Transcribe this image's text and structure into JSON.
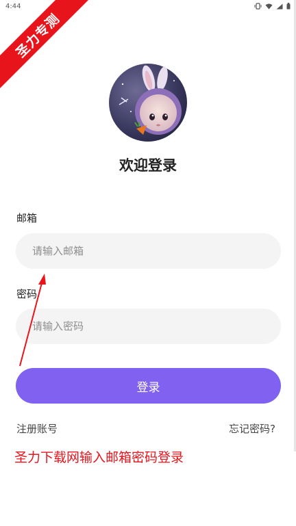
{
  "status_bar": {
    "time": "4:44",
    "icons": [
      "vibrate-icon",
      "wifi-icon",
      "signal-icon",
      "battery-icon"
    ]
  },
  "watermark": {
    "ribbon_text": "圣力专测",
    "caption": "圣力下载网输入邮箱密码登录"
  },
  "login": {
    "title": "欢迎登录",
    "email_label": "邮箱",
    "email_placeholder": "请输入邮箱",
    "email_value": "",
    "password_label": "密码",
    "password_placeholder": "请输入密码",
    "password_value": "",
    "submit_label": "登录",
    "register_link": "注册账号",
    "forgot_link": "忘记密码?"
  },
  "colors": {
    "accent": "#8162f0",
    "input_bg": "#f4f4f4",
    "ribbon": "#e8141b",
    "annotation": "#e8141b"
  }
}
